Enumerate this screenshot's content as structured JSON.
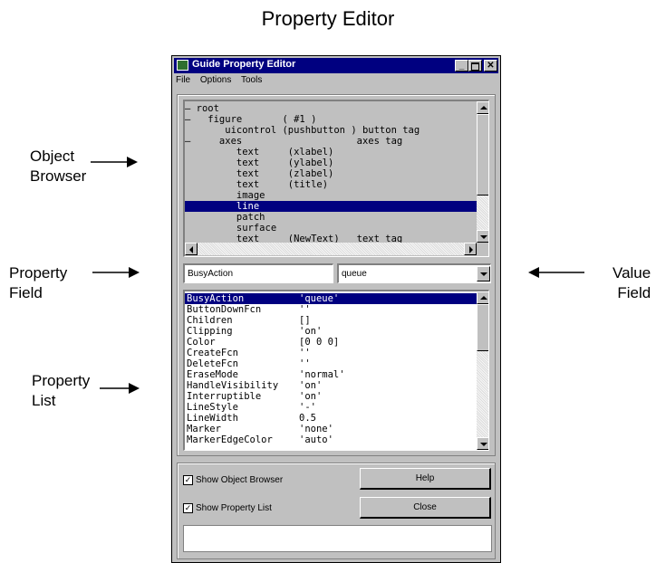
{
  "figure_title": "Property Editor",
  "callouts": {
    "object_browser": [
      "Object",
      "Browser"
    ],
    "property_field": [
      "Property",
      "Field"
    ],
    "property_list": [
      "Property",
      "List"
    ],
    "value_field": [
      "Value",
      "Field"
    ]
  },
  "window": {
    "title": "Guide Property Editor",
    "menu": [
      "File",
      "Options",
      "Tools"
    ]
  },
  "object_browser": {
    "rows": [
      "– root",
      "–   figure       ( #1 )",
      "       uicontrol (pushbutton ) button tag",
      "–     axes                    axes tag",
      "         text     (xlabel)",
      "         text     (ylabel)",
      "         text     (zlabel)",
      "         text     (title)",
      "         image",
      "         line",
      "         patch",
      "         surface",
      "         text     (NewText)   text tag"
    ],
    "selected_index": 9
  },
  "property_field": {
    "value": "BusyAction"
  },
  "value_field": {
    "value": "queue"
  },
  "property_list": {
    "rows": [
      {
        "name": "BusyAction",
        "value": "'queue'"
      },
      {
        "name": "ButtonDownFcn",
        "value": "''"
      },
      {
        "name": "Children",
        "value": "[]"
      },
      {
        "name": "Clipping",
        "value": "'on'"
      },
      {
        "name": "Color",
        "value": "[0 0 0]"
      },
      {
        "name": "CreateFcn",
        "value": "''"
      },
      {
        "name": "DeleteFcn",
        "value": "''"
      },
      {
        "name": "EraseMode",
        "value": "'normal'"
      },
      {
        "name": "HandleVisibility",
        "value": "'on'"
      },
      {
        "name": "Interruptible",
        "value": "'on'"
      },
      {
        "name": "LineStyle",
        "value": "'-'"
      },
      {
        "name": "LineWidth",
        "value": "0.5"
      },
      {
        "name": "Marker",
        "value": "'none'"
      },
      {
        "name": "MarkerEdgeColor",
        "value": "'auto'"
      }
    ],
    "selected_index": 0
  },
  "options": {
    "show_object_browser": {
      "label": "Show Object Browser",
      "checked": true
    },
    "show_property_list": {
      "label": "Show Property List",
      "checked": true
    }
  },
  "buttons": {
    "help": "Help",
    "close": "Close"
  },
  "colors": {
    "selection": "#000080",
    "titlebar": "#000080",
    "face": "#c0c0c0"
  }
}
